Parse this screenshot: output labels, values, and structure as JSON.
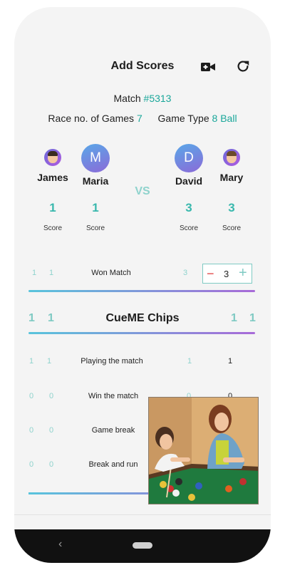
{
  "header": {
    "title": "Add Scores",
    "camera_icon": "video-add-icon",
    "refresh_icon": "refresh-icon"
  },
  "match": {
    "label": "Match",
    "number": "#5313"
  },
  "race": {
    "label": "Race no. of Games",
    "value": "7"
  },
  "game_type": {
    "label": "Game Type",
    "value": "8 Ball"
  },
  "players": [
    {
      "name": "James",
      "score": "1",
      "score_label": "Score",
      "avatar": "photo"
    },
    {
      "name": "Maria",
      "score": "1",
      "score_label": "Score",
      "avatar": "M"
    },
    {
      "name": "David",
      "score": "3",
      "score_label": "Score",
      "avatar": "D"
    },
    {
      "name": "Mary",
      "score": "3",
      "score_label": "Score",
      "avatar": "photo"
    }
  ],
  "vs_label": "VS",
  "won_match": {
    "left_a": "1",
    "left_b": "1",
    "label": "Won Match",
    "right_a": "3",
    "stepper_value": "3",
    "minus": "−",
    "plus": "+"
  },
  "chips": {
    "title": "CueME Chips",
    "left_a": "1",
    "left_b": "1",
    "right_a": "1",
    "right_b": "1"
  },
  "chip_rows": [
    {
      "left_a": "1",
      "left_b": "1",
      "label": "Playing the match",
      "right_a": "1",
      "right_b": "1"
    },
    {
      "left_a": "0",
      "left_b": "0",
      "label": "Win the match",
      "right_a": "0",
      "right_b": "0"
    },
    {
      "left_a": "0",
      "left_b": "0",
      "label": "Game break",
      "right_a": "",
      "right_b": ""
    },
    {
      "left_a": "0",
      "left_b": "0",
      "label": "Break and run",
      "right_a": "",
      "right_b": ""
    }
  ],
  "nav": {
    "back": "‹"
  },
  "colors": {
    "accent": "#1aa79a",
    "light_accent": "#8fd3cd",
    "gradient_start": "#58c4dc",
    "gradient_end": "#a86ad8"
  }
}
